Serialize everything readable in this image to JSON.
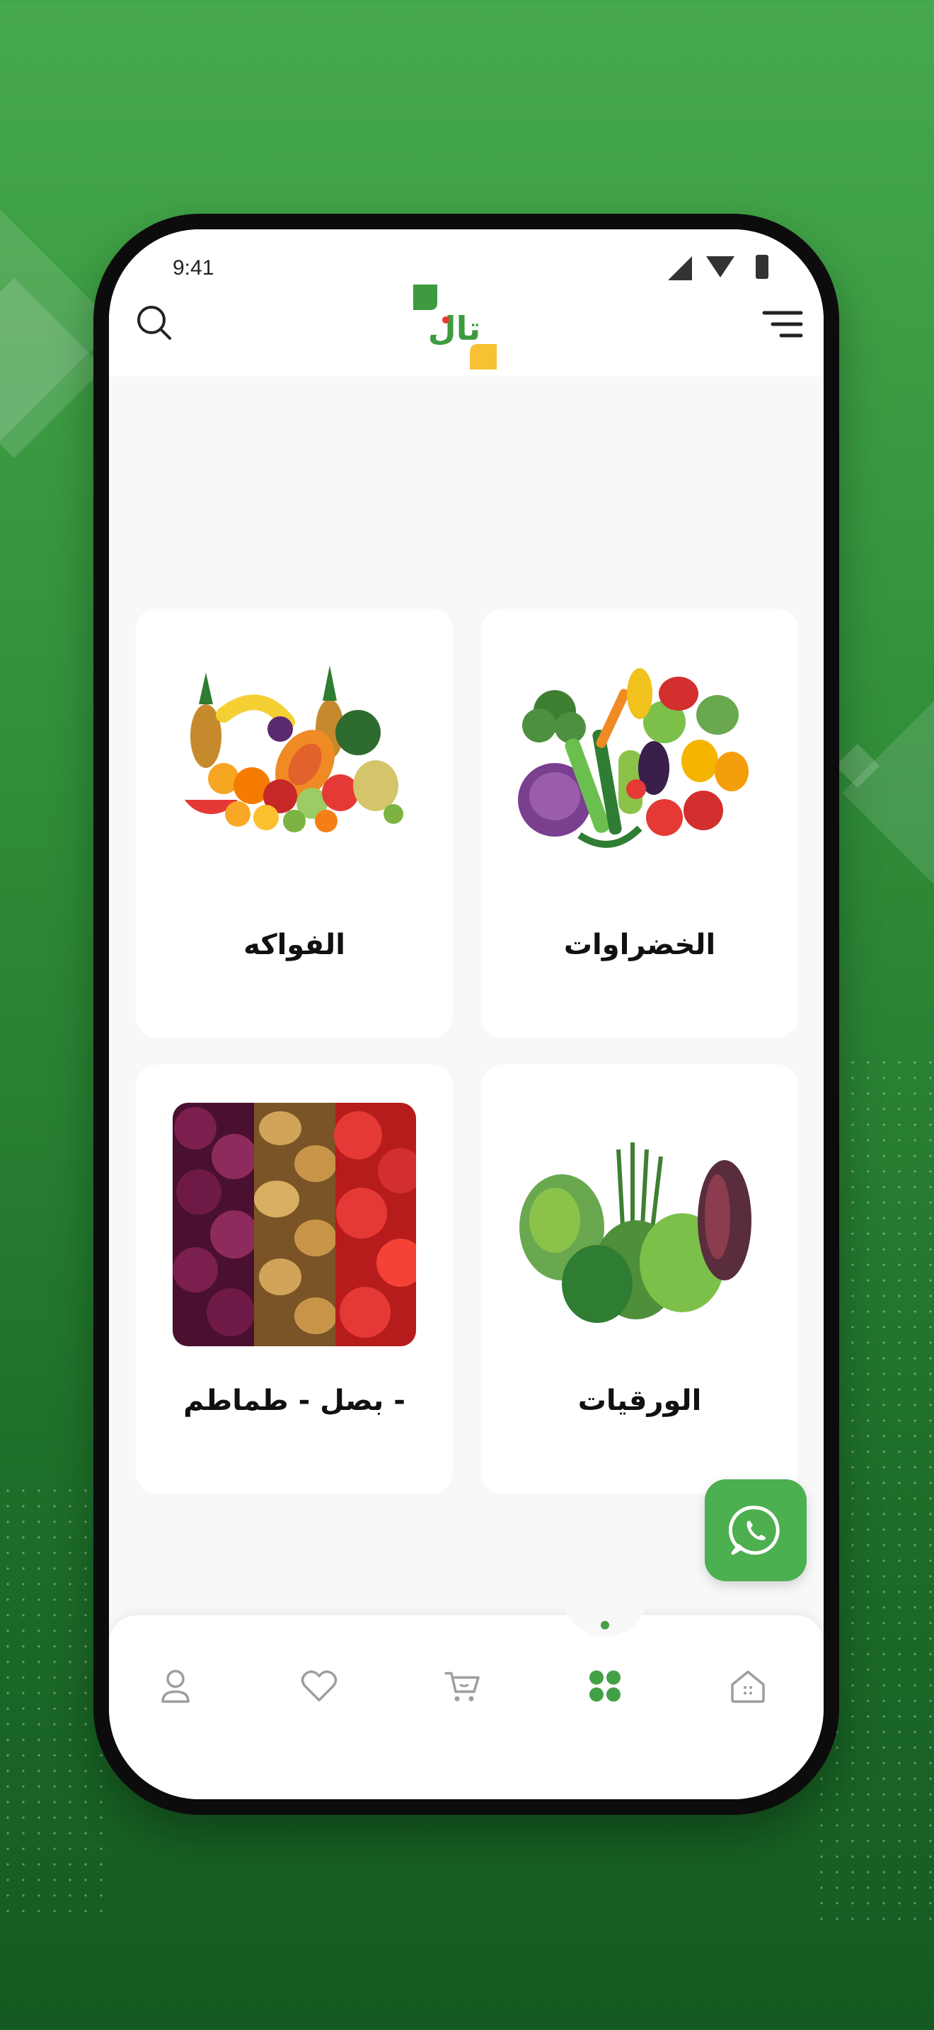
{
  "status_bar": {
    "time": "9:41"
  },
  "header": {
    "logo_alt": "تال",
    "search_icon": "search-icon",
    "menu_icon": "menu-icon"
  },
  "categories": [
    {
      "label": "الخضراوات",
      "image": "vegetables"
    },
    {
      "label": "الفواكه",
      "image": "fruits"
    },
    {
      "label": "الورقيات",
      "image": "leafy-greens"
    },
    {
      "label": "بصل - طماطم -",
      "image": "onion-potato-tomato"
    }
  ],
  "fab": {
    "icon": "whatsapp-icon",
    "color": "#4caf50"
  },
  "tab_bar": {
    "items": [
      {
        "icon": "profile-icon"
      },
      {
        "icon": "heart-icon"
      },
      {
        "icon": "cart-icon"
      },
      {
        "icon": "categories-icon",
        "active": true
      },
      {
        "icon": "home-icon"
      }
    ],
    "active_color": "#43a047"
  },
  "colors": {
    "brand_green": "#43a047",
    "brand_yellow": "#f6c233",
    "background": "#2f8c38"
  }
}
